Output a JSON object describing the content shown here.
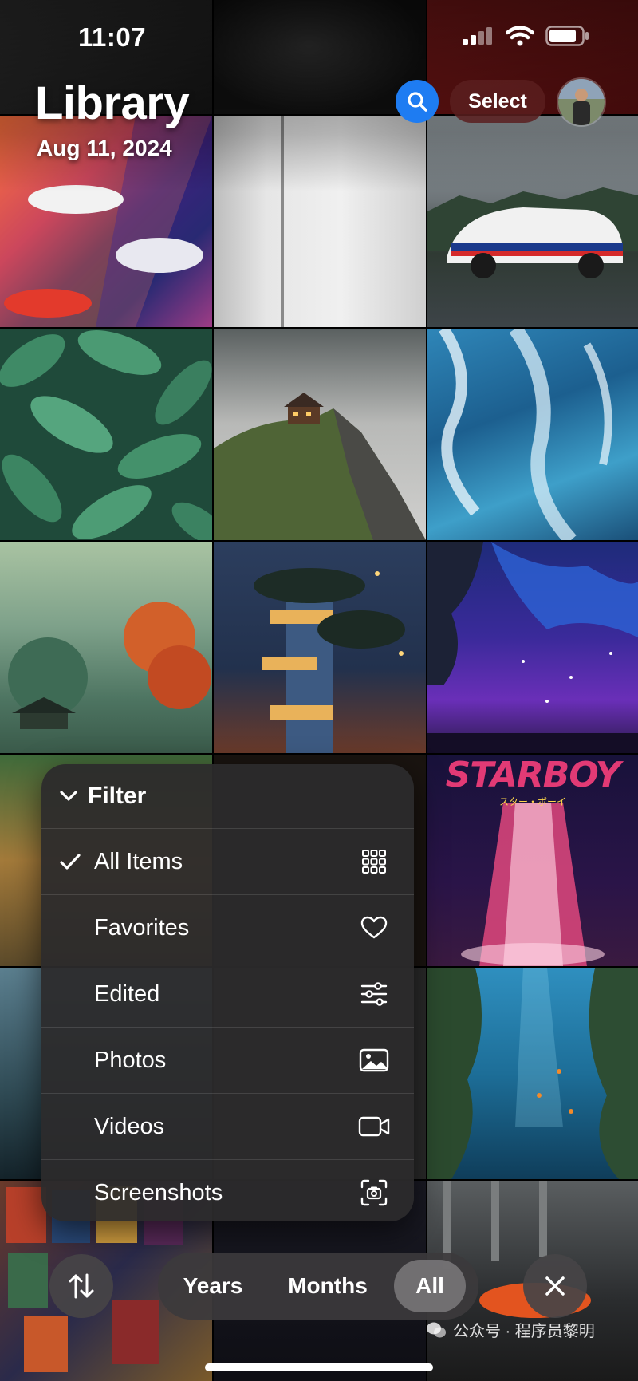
{
  "status_bar": {
    "time": "11:07"
  },
  "header": {
    "title": "Library",
    "date": "Aug 11, 2024",
    "select_label": "Select"
  },
  "filter_menu": {
    "title": "Filter",
    "items": [
      {
        "label": "All Items",
        "checked": true,
        "icon": "grid-icon"
      },
      {
        "label": "Favorites",
        "checked": false,
        "icon": "heart-icon"
      },
      {
        "label": "Edited",
        "checked": false,
        "icon": "sliders-icon"
      },
      {
        "label": "Photos",
        "checked": false,
        "icon": "photo-icon"
      },
      {
        "label": "Videos",
        "checked": false,
        "icon": "video-icon"
      },
      {
        "label": "Screenshots",
        "checked": false,
        "icon": "screenshot-icon"
      }
    ]
  },
  "bottom_bar": {
    "segments": [
      "Years",
      "Months",
      "All"
    ],
    "selected": "All"
  },
  "grid_tiles": [
    {
      "name": "photo-car-collage"
    },
    {
      "name": "photo-light-wall"
    },
    {
      "name": "photo-race-car"
    },
    {
      "name": "photo-leaves"
    },
    {
      "name": "photo-mountain-house"
    },
    {
      "name": "photo-ocean-waves"
    },
    {
      "name": "photo-forest-painting"
    },
    {
      "name": "photo-tree-house"
    },
    {
      "name": "photo-night-sky"
    },
    {
      "name": "photo-hills"
    },
    {
      "name": "photo-planets"
    },
    {
      "name": "photo-starboy-poster"
    },
    {
      "name": "photo-misty-forest"
    },
    {
      "name": "photo-dark-portrait"
    },
    {
      "name": "photo-underwater"
    },
    {
      "name": "photo-movie-posters"
    },
    {
      "name": "photo-city-night"
    },
    {
      "name": "photo-car-tunnel"
    }
  ],
  "starboy_text": "STARBOY",
  "starboy_subtext": "スター・ボーイ",
  "watermark": "公众号 · 程序员黎明",
  "colors": {
    "accent": "#1e7cf2"
  }
}
